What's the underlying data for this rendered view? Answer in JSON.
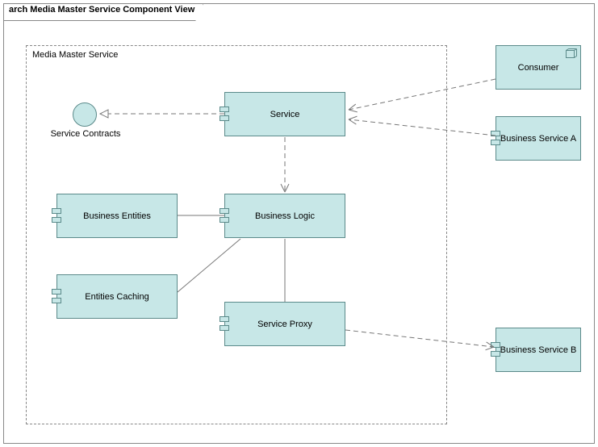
{
  "frame": {
    "title": "arch Media Master Service Component View"
  },
  "package": {
    "label": "Media Master Service"
  },
  "interface": {
    "serviceContracts": "Service Contracts"
  },
  "components": {
    "service": "Service",
    "businessEntities": "Business Entities",
    "businessLogic": "Business Logic",
    "entitiesCaching": "Entities Caching",
    "serviceProxy": "Service Proxy",
    "consumer": "Consumer",
    "businessServiceA": "Business Service A",
    "businessServiceB": "Business Service B"
  }
}
